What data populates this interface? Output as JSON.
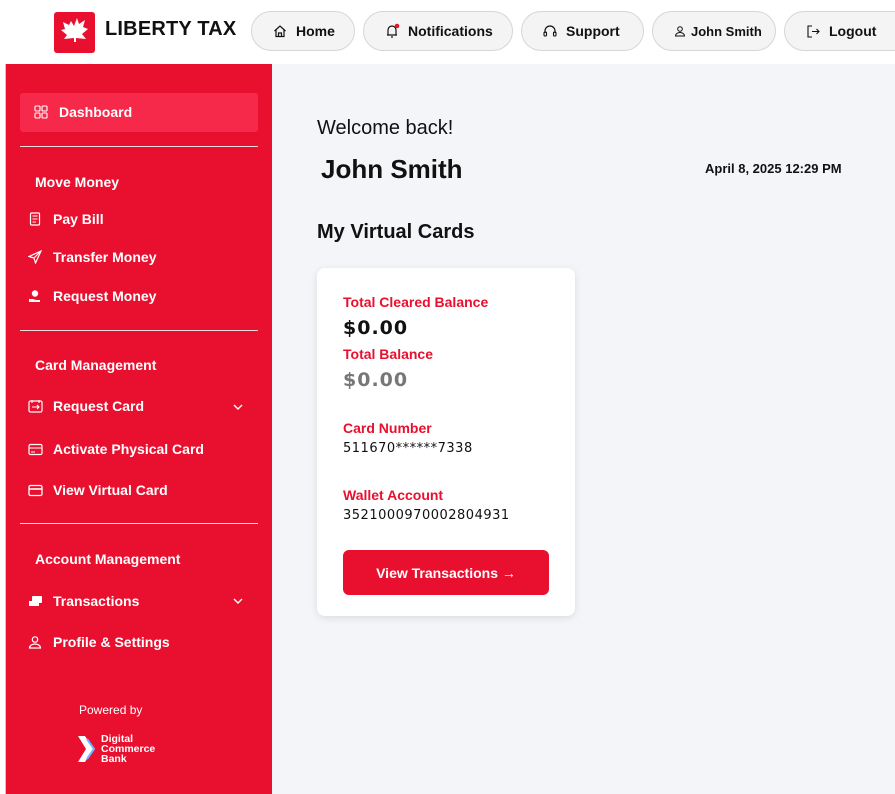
{
  "header": {
    "brand": "LIBERTY TAX",
    "nav": {
      "home": "Home",
      "notifications": "Notifications",
      "support": "Support",
      "user": "John Smith",
      "logout": "Logout"
    }
  },
  "sidebar": {
    "dashboard": "Dashboard",
    "move_money": {
      "heading": "Move Money",
      "pay_bill": "Pay Bill",
      "transfer_money": "Transfer Money",
      "request_money": "Request Money"
    },
    "card_management": {
      "heading": "Card Management",
      "request_card": "Request Card",
      "activate_physical_card": "Activate Physical Card",
      "view_virtual_card": "View Virtual Card"
    },
    "account_management": {
      "heading": "Account Management",
      "transactions": "Transactions",
      "profile_settings": "Profile & Settings"
    },
    "footer": {
      "powered_by": "Powered by",
      "bank_line1": "Digital",
      "bank_line2": "Commerce",
      "bank_line3": "Bank"
    }
  },
  "main": {
    "welcome": "Welcome back!",
    "user_name": "John Smith",
    "datetime": "April 8, 2025 12:29 PM",
    "section_title": "My Virtual Cards",
    "card": {
      "cleared_label": "Total Cleared Balance",
      "cleared_value": "$0.00",
      "total_label": "Total Balance",
      "total_value": "$0.00",
      "card_number_label": "Card Number",
      "card_number_value": "511670******7338",
      "wallet_label": "Wallet Account",
      "wallet_value": "3521000970002804931",
      "button": "View Transactions →"
    }
  },
  "colors": {
    "brand_red": "#e8102e",
    "main_bg": "#f3f5f8"
  }
}
